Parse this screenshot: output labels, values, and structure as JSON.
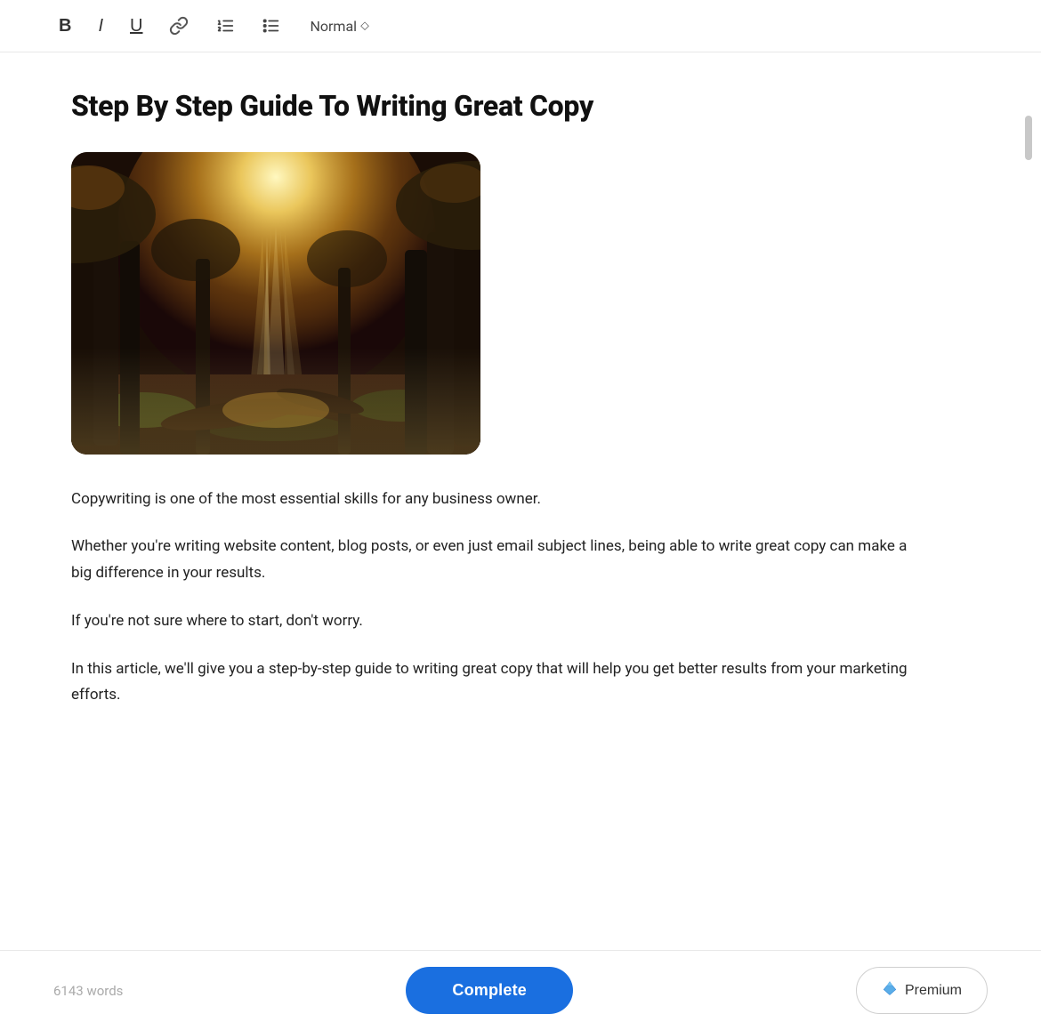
{
  "toolbar": {
    "bold_label": "B",
    "italic_label": "I",
    "underline_label": "U",
    "style_label": "Normal",
    "style_arrow": "⬦"
  },
  "article": {
    "title": "Step By Step Guide To Writing Great Copy",
    "image_alt": "Forest scene with sunlight rays",
    "paragraphs": [
      "Copywriting is one of the most essential skills for any business owner.",
      "Whether you're writing website content, blog posts, or even just email subject lines, being able to write great copy can make a big difference in your results.",
      "If you're not sure where to start, don't worry.",
      "In this article, we'll give you a step-by-step guide to writing great copy that will help you get better results from your marketing efforts."
    ]
  },
  "bottom_bar": {
    "word_count": "6143 words",
    "complete_label": "Complete",
    "premium_label": "Premium"
  },
  "icons": {
    "bold": "B",
    "italic": "I",
    "underline": "U",
    "link": "🔗",
    "ordered_list": "≡",
    "unordered_list": "☰",
    "dropdown_arrow": "⬦",
    "diamond": "💎"
  }
}
